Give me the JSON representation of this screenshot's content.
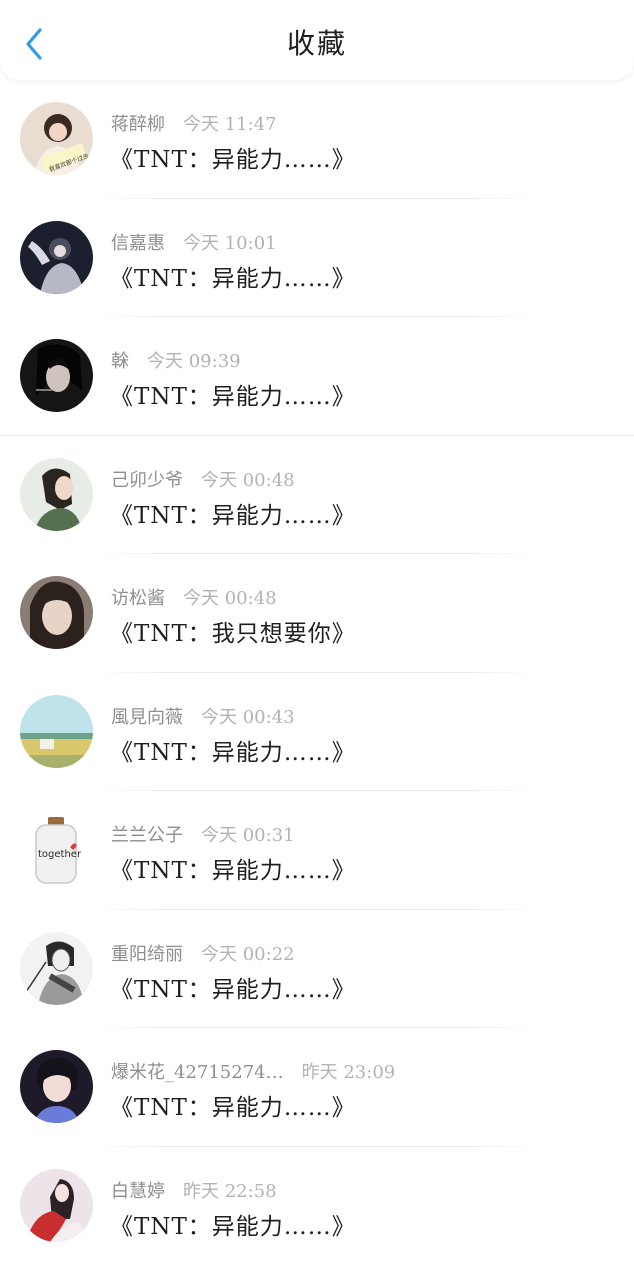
{
  "header": {
    "title": "收藏",
    "back_icon": "chevron-left-icon",
    "accent": "#2f9ce8"
  },
  "items": [
    {
      "name": "蒋醉柳",
      "time": "今天 11:47",
      "text": "《TNT：异能力……》"
    },
    {
      "name": "信嘉惠",
      "time": "今天 10:01",
      "text": "《TNT：异能力……》"
    },
    {
      "name": "榦",
      "time": "今天 09:39",
      "text": "《TNT：异能力……》"
    },
    {
      "name": "己卯少爷",
      "time": "今天 00:48",
      "text": "《TNT：异能力……》"
    },
    {
      "name": "访松酱",
      "time": "今天 00:48",
      "text": "《TNT：我只想要你》"
    },
    {
      "name": "風見向薇",
      "time": "今天 00:43",
      "text": "《TNT：异能力……》"
    },
    {
      "name": "兰兰公子",
      "time": "今天 00:31",
      "text": "《TNT：异能力……》"
    },
    {
      "name": "重阳绮丽",
      "time": "今天 00:22",
      "text": "《TNT：异能力……》"
    },
    {
      "name": "爆米花_42715274…",
      "time": "昨天 23:09",
      "text": "《TNT：异能力……》"
    },
    {
      "name": "白慧婷",
      "time": "昨天 22:58",
      "text": "《TNT：异能力……》"
    }
  ],
  "avatar_labels": {
    "row1": "我喜欢那个过去",
    "row7": "together"
  }
}
